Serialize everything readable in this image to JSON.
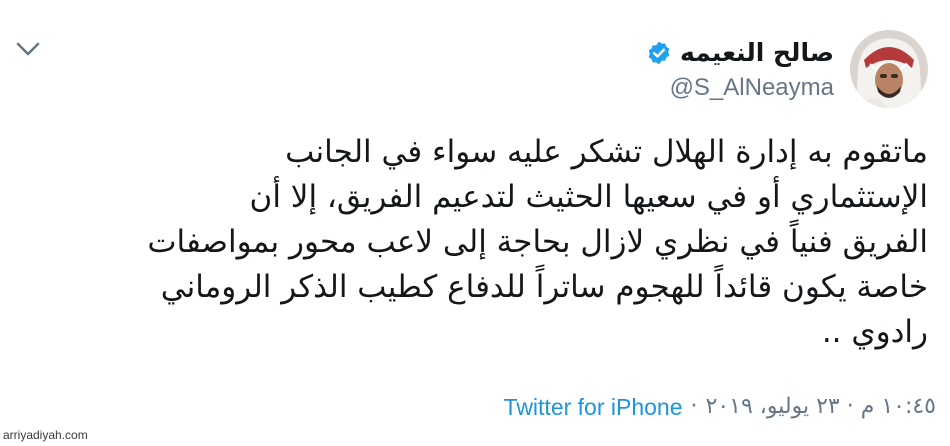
{
  "tweet": {
    "author": {
      "display_name": "صالح النعيمه",
      "handle": "@S_AlNeayma",
      "verified": true
    },
    "text_lines": [
      "ماتقوم به إدارة الهلال تشكر عليه سواء في الجانب",
      "الإستثماري أو في سعيها الحثيث لتدعيم الفريق، إلا أن",
      "الفريق فنياً في نظري لازال بحاجة إلى لاعب محور بمواصفات",
      "خاصة يكون قائداً للهجوم ساتراً للدفاع كطيب الذكر الروماني",
      "رادوي .."
    ],
    "timestamp": "١٠:٤٥ م · ٢٣ يوليو، ٢٠١٩",
    "separator": "·",
    "source": "Twitter for iPhone"
  },
  "menu": {
    "icon": "chevron-down-icon"
  },
  "watermark": "arriyadiyah.com",
  "colors": {
    "text": "#14171a",
    "secondary": "#657786",
    "link": "#1b95e0",
    "verified": "#1da1f2"
  }
}
